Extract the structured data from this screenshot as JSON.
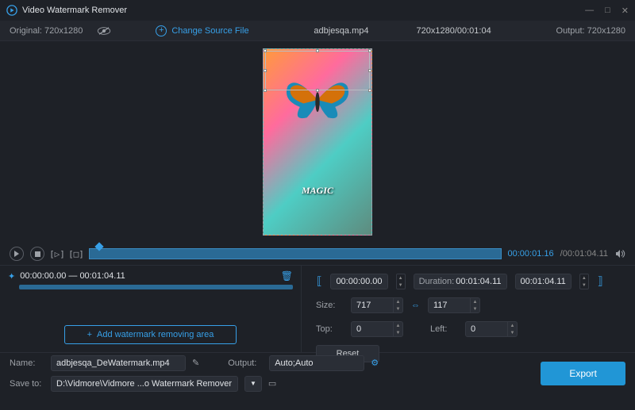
{
  "window": {
    "title": "Video Watermark Remover"
  },
  "header": {
    "original_label": "Original: 720x1280",
    "change_source": "Change Source File",
    "filename": "adbjesqa.mp4",
    "res_time": "720x1280/00:01:04",
    "output_label": "Output: 720x1280"
  },
  "preview": {
    "magic_text": "MAGIC"
  },
  "timeline": {
    "current": "00:00:01.16",
    "total": "/00:01:04.11"
  },
  "watermark": {
    "range": "00:00:00.00 — 00:01:04.11",
    "add_button": "Add watermark removing area"
  },
  "props": {
    "start": "00:00:00.00",
    "duration_label": "Duration:",
    "duration": "00:01:04.11",
    "end": "00:01:04.11",
    "size_label": "Size:",
    "size_w": "717",
    "size_h": "117",
    "top_label": "Top:",
    "top": "0",
    "left_label": "Left:",
    "left": "0",
    "reset": "Reset"
  },
  "bottom": {
    "name_label": "Name:",
    "name": "adbjesqa_DeWatermark.mp4",
    "output_label": "Output:",
    "output": "Auto;Auto",
    "saveto_label": "Save to:",
    "saveto": "D:\\Vidmore\\Vidmore ...o Watermark Remover",
    "export": "Export"
  }
}
